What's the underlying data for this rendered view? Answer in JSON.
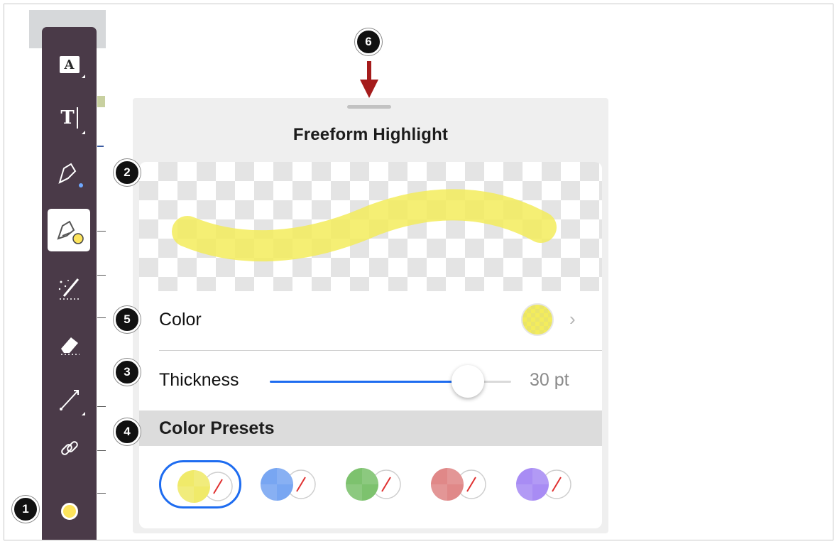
{
  "toolbar": {
    "items": [
      {
        "id": "text-box",
        "icon": "text-box-icon",
        "glyph": "A"
      },
      {
        "id": "text",
        "icon": "text-cursor-icon",
        "glyph": "T"
      },
      {
        "id": "freehand",
        "icon": "pen-icon"
      },
      {
        "id": "highlighter",
        "icon": "highlighter-icon",
        "selected": true
      },
      {
        "id": "magic",
        "icon": "magic-wand-icon"
      },
      {
        "id": "eraser",
        "icon": "eraser-icon"
      },
      {
        "id": "line",
        "icon": "line-icon"
      },
      {
        "id": "link",
        "icon": "link-icon"
      },
      {
        "id": "color",
        "icon": "color-dot-icon"
      }
    ],
    "current_color": "#fde45c"
  },
  "panel": {
    "title": "Freeform Highlight",
    "color_label": "Color",
    "thickness_label": "Thickness",
    "thickness_value": "30 pt",
    "thickness_fraction": 0.82,
    "presets_label": "Color Presets",
    "highlight_color": "#f3ec5c",
    "presets": [
      {
        "color": "#f0ea6a",
        "active": true
      },
      {
        "color": "#78a6f2",
        "active": false
      },
      {
        "color": "#7dc26e",
        "active": false
      },
      {
        "color": "#e08888",
        "active": false
      },
      {
        "color": "#a88cf4",
        "active": false
      }
    ]
  },
  "callouts": [
    "1",
    "2",
    "3",
    "4",
    "5",
    "6"
  ],
  "accent_color": "#1e6cf0",
  "arrow_color": "#a51c1c"
}
